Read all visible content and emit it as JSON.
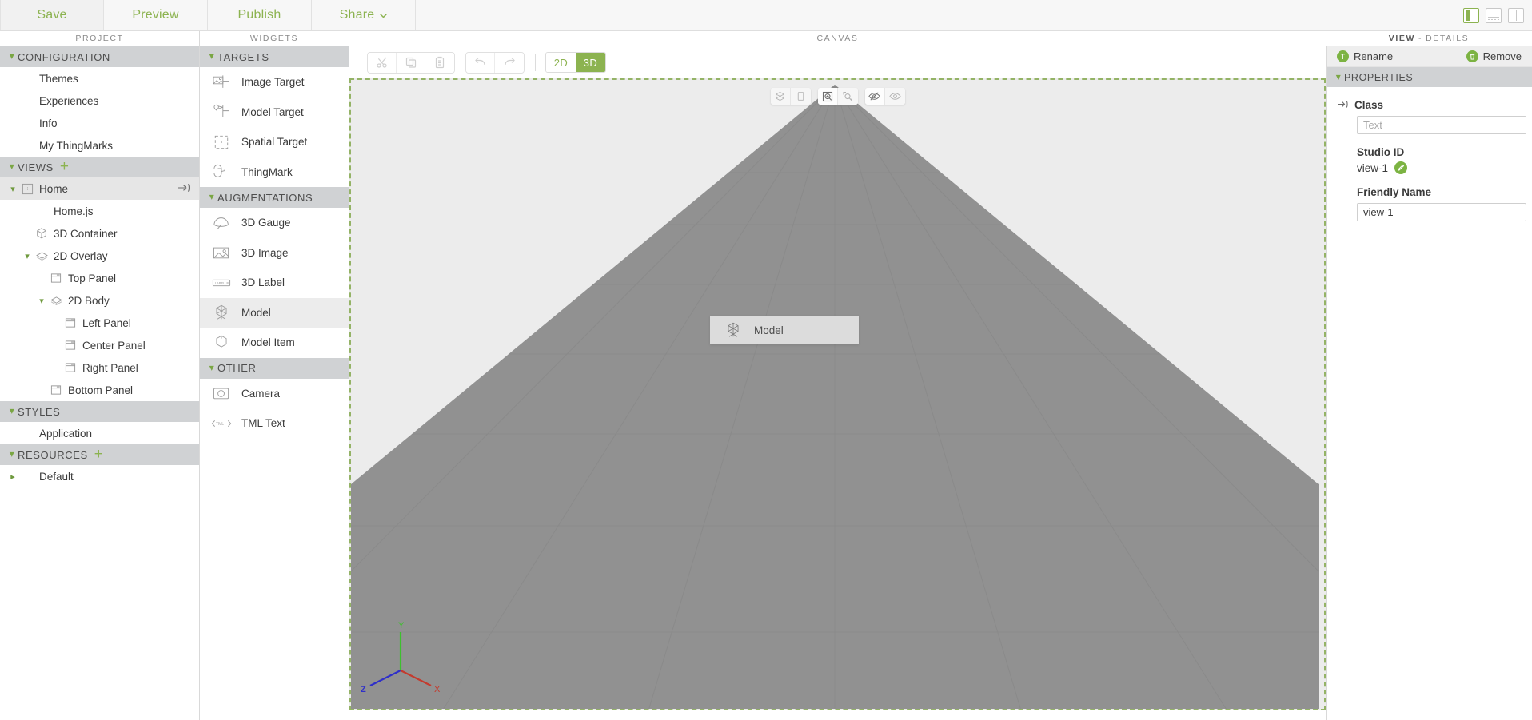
{
  "accent": "#8cb350",
  "accent_dark": "#7cb342",
  "topbar": {
    "menu": [
      {
        "label": "Save",
        "name": "save"
      },
      {
        "label": "Preview",
        "name": "preview"
      },
      {
        "label": "Publish",
        "name": "publish"
      },
      {
        "label": "Share",
        "name": "share",
        "caret": "⌄"
      }
    ],
    "layout_toggles": [
      {
        "name": "layout-left-panel-toggle",
        "state": "active"
      },
      {
        "name": "layout-bottom-panel-toggle",
        "state": "inactive"
      },
      {
        "name": "layout-right-panel-toggle",
        "state": "inactive"
      }
    ]
  },
  "column_headers": {
    "project": "PROJECT",
    "widgets": "WIDGETS",
    "canvas": "CANVAS",
    "details_prefix": "VIEW",
    "details_sep": "-",
    "details_suffix": "DETAILS"
  },
  "project_tree": {
    "sections": [
      {
        "label": "CONFIGURATION",
        "name": "configuration",
        "expanded": true,
        "has_add": false,
        "items": [
          {
            "label": "Themes",
            "name": "themes",
            "indent": 1,
            "icon": "none"
          },
          {
            "label": "Experiences",
            "name": "experiences",
            "indent": 1,
            "icon": "none"
          },
          {
            "label": "Info",
            "name": "info",
            "indent": 1,
            "icon": "none"
          },
          {
            "label": "My ThingMarks",
            "name": "my-thingmarks",
            "indent": 1,
            "icon": "none"
          }
        ]
      },
      {
        "label": "VIEWS",
        "name": "views",
        "expanded": true,
        "has_add": true,
        "items": [
          {
            "label": "Home",
            "name": "home",
            "indent": 1,
            "icon": "view",
            "chev": "down",
            "selected": true,
            "goto": "→)"
          },
          {
            "label": "Home.js",
            "name": "home-js",
            "indent": 2,
            "icon": "none"
          },
          {
            "label": "3D Container",
            "name": "3d-container",
            "indent": 2,
            "icon": "cube"
          },
          {
            "label": "2D Overlay",
            "name": "2d-overlay",
            "indent": 2,
            "icon": "layer",
            "chev": "down"
          },
          {
            "label": "Top Panel",
            "name": "top-panel",
            "indent": 3,
            "icon": "panel"
          },
          {
            "label": "2D Body",
            "name": "2d-body",
            "indent": 3,
            "icon": "layer",
            "chev": "down"
          },
          {
            "label": "Left Panel",
            "name": "left-panel",
            "indent": 4,
            "icon": "panel"
          },
          {
            "label": "Center Panel",
            "name": "center-panel",
            "indent": 4,
            "icon": "panel"
          },
          {
            "label": "Right Panel",
            "name": "right-panel",
            "indent": 4,
            "icon": "panel"
          },
          {
            "label": "Bottom Panel",
            "name": "bottom-panel",
            "indent": 3,
            "icon": "panel"
          }
        ]
      },
      {
        "label": "STYLES",
        "name": "styles",
        "expanded": true,
        "has_add": false,
        "items": [
          {
            "label": "Application",
            "name": "application",
            "indent": 1,
            "icon": "none"
          }
        ]
      },
      {
        "label": "RESOURCES",
        "name": "resources",
        "expanded": true,
        "has_add": true,
        "items": [
          {
            "label": "Default",
            "name": "default",
            "indent": 1,
            "icon": "none",
            "chev": "right"
          }
        ]
      }
    ]
  },
  "widgets_panel": {
    "groups": [
      {
        "label": "TARGETS",
        "name": "targets",
        "items": [
          {
            "label": "Image Target",
            "name": "image-target",
            "icon": "image-target-icon"
          },
          {
            "label": "Model Target",
            "name": "model-target",
            "icon": "model-target-icon"
          },
          {
            "label": "Spatial Target",
            "name": "spatial-target",
            "icon": "spatial-target-icon"
          },
          {
            "label": "ThingMark",
            "name": "thingmark",
            "icon": "thingmark-icon"
          }
        ]
      },
      {
        "label": "AUGMENTATIONS",
        "name": "augmentations",
        "items": [
          {
            "label": "3D Gauge",
            "name": "3d-gauge",
            "icon": "gauge-icon"
          },
          {
            "label": "3D Image",
            "name": "3d-image",
            "icon": "picture-icon"
          },
          {
            "label": "3D Label",
            "name": "3d-label",
            "icon": "label-icon"
          },
          {
            "label": "Model",
            "name": "model",
            "icon": "model-icon",
            "active": true
          },
          {
            "label": "Model Item",
            "name": "model-item",
            "icon": "model-item-icon"
          }
        ]
      },
      {
        "label": "OTHER",
        "name": "other",
        "items": [
          {
            "label": "Camera",
            "name": "camera",
            "icon": "camera-icon"
          },
          {
            "label": "TML Text",
            "name": "tml-text",
            "icon": "tml-icon"
          }
        ]
      }
    ]
  },
  "canvas": {
    "toolbar": {
      "edit_buttons": [
        {
          "name": "cut-button",
          "icon": "scissors-icon"
        },
        {
          "name": "copy-button",
          "icon": "copy-icon"
        },
        {
          "name": "paste-button",
          "icon": "clipboard-icon"
        }
      ],
      "history_buttons": [
        {
          "name": "undo-button",
          "icon": "undo-icon"
        },
        {
          "name": "redo-button",
          "icon": "redo-icon"
        }
      ],
      "dimension": {
        "options": [
          "2D",
          "3D"
        ],
        "selected": "3D"
      }
    },
    "float_toolbar": [
      {
        "name": "perspective-view-button",
        "icon": "wireframe-cube-icon",
        "lit": false
      },
      {
        "name": "flat-view-button",
        "icon": "plane-icon",
        "lit": false
      },
      {
        "name": "zoom-in-button",
        "icon": "zoom-in-icon",
        "lit": true
      },
      {
        "name": "zoom-fit-button",
        "icon": "zoom-fit-icon",
        "lit": false
      },
      {
        "name": "hide-annotations-button",
        "icon": "eye-slash-icon",
        "lit": true
      },
      {
        "name": "show-annotations-button",
        "icon": "eye-icon",
        "lit": false
      }
    ],
    "drag_ghost": {
      "label": "Model",
      "icon": "model-icon"
    },
    "axis_gizmo": {
      "x_label": "X",
      "y_label": "Y",
      "z_label": "Z",
      "x_color": "#c33b2e",
      "y_color": "#3ec02e",
      "z_color": "#2f2fc9"
    },
    "colors": {
      "sky": "#ececec",
      "ground": "#919191",
      "grid_line": "#8b8b8b",
      "drop_border": "#94b366"
    }
  },
  "details": {
    "actions": [
      {
        "label": "Rename",
        "name": "rename-button",
        "glyph": "T"
      },
      {
        "label": "Remove",
        "name": "remove-button",
        "glyph": "Ὕ1"
      }
    ],
    "properties_header": "PROPERTIES",
    "fields": [
      {
        "label": "Class",
        "name": "class",
        "kind": "input",
        "value": "",
        "placeholder": "Text",
        "has_arrow_icon": true
      },
      {
        "label": "Studio ID",
        "name": "studio-id",
        "kind": "readonly",
        "value": "view-1",
        "has_pencil": true
      },
      {
        "label": "Friendly Name",
        "name": "friendly-name",
        "kind": "input",
        "value": "view-1",
        "placeholder": ""
      }
    ]
  }
}
